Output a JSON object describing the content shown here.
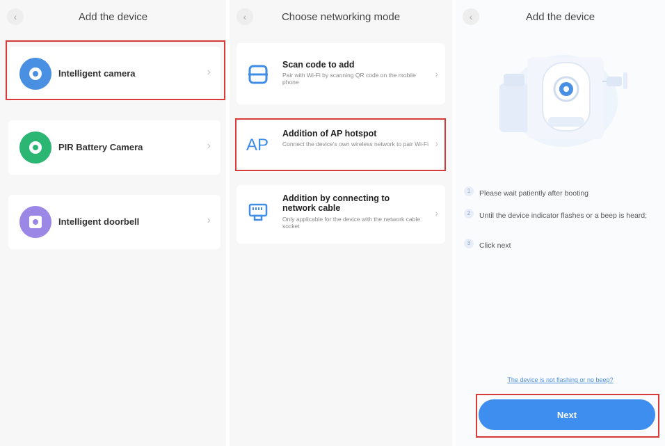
{
  "colors": {
    "accent": "#3e8ef0",
    "highlight": "#d83a3a",
    "camera": "#4a90e2",
    "pir": "#2bb673",
    "doorbell": "#9b87e6"
  },
  "panel1": {
    "back_icon": "‹",
    "title": "Add the device",
    "devices": [
      {
        "label": "Intelligent camera",
        "icon": "camera-icon"
      },
      {
        "label": "PIR Battery Camera",
        "icon": "pir-camera-icon"
      },
      {
        "label": "Intelligent doorbell",
        "icon": "doorbell-icon"
      }
    ],
    "chevron": "›"
  },
  "panel2": {
    "back_icon": "‹",
    "title": "Choose networking mode",
    "modes": [
      {
        "title": "Scan code to add",
        "desc": "Pair with Wi-Fi by scanning QR code on the mobile phone",
        "icon": "scan-icon"
      },
      {
        "title": "Addition of AP hotspot",
        "desc": "Connect the device's own wireless network to pair Wi-Fi",
        "icon": "ap-icon",
        "icon_text": "AP"
      },
      {
        "title": "Addition by connecting to network cable",
        "desc": "Only applicable for the device with the network cable socket",
        "icon": "ethernet-icon"
      }
    ],
    "chevron": "›"
  },
  "panel3": {
    "back_icon": "‹",
    "title": "Add the device",
    "steps": [
      {
        "num": "1",
        "text": "Please wait patiently after booting"
      },
      {
        "num": "2",
        "text": "Until the device indicator flashes or a beep is heard;"
      },
      {
        "num": "3",
        "text": "Click next"
      }
    ],
    "help_link": "The device is not flashing or no beep?",
    "next_label": "Next"
  }
}
